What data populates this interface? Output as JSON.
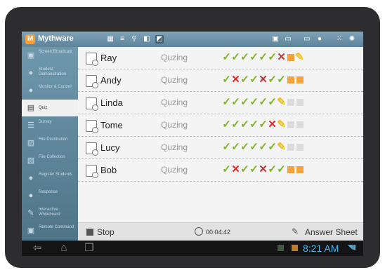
{
  "app": {
    "name": "Mythware",
    "logo_glyph": "M"
  },
  "toolbar": {
    "left_icons": [
      "grid-icon",
      "list-icon",
      "tree-icon",
      "window-icon",
      "quiz-mode-icon"
    ],
    "right_icons": [
      "screen-icon",
      "monitor-icon",
      "display-icon",
      "chat-icon",
      "apps-icon",
      "settings-icon"
    ]
  },
  "sidebar": {
    "items": [
      {
        "label": "Screen Broadcast",
        "icon": "broadcast-icon"
      },
      {
        "label": "Student Demonstration",
        "icon": "student-demo-icon"
      },
      {
        "label": "Monitor & Control",
        "icon": "monitor-control-icon"
      },
      {
        "label": "Quiz",
        "icon": "quiz-icon",
        "active": true
      },
      {
        "label": "Survey",
        "icon": "survey-icon"
      },
      {
        "label": "File Distribution",
        "icon": "file-distribution-icon"
      },
      {
        "label": "File Collection",
        "icon": "file-collection-icon"
      },
      {
        "label": "Register Students",
        "icon": "register-icon"
      },
      {
        "label": "Response",
        "icon": "response-icon"
      },
      {
        "label": "Interactive Whiteboard",
        "icon": "whiteboard-icon"
      },
      {
        "label": "Remote Command",
        "icon": "remote-command-icon"
      }
    ]
  },
  "students": [
    {
      "name": "Ray",
      "status": "Quzing",
      "marks": [
        "ok",
        "ok",
        "ok",
        "ok",
        "ok",
        "ok",
        "err",
        "orange",
        "pen"
      ]
    },
    {
      "name": "Andy",
      "status": "Quzing",
      "marks": [
        "ok",
        "err",
        "ok",
        "ok",
        "err",
        "ok",
        "ok",
        "orange",
        "orange"
      ]
    },
    {
      "name": "Linda",
      "status": "Quzing",
      "marks": [
        "ok",
        "ok",
        "ok",
        "ok",
        "ok",
        "ok",
        "pen",
        "grey",
        "grey"
      ]
    },
    {
      "name": "Tome",
      "status": "Quzing",
      "marks": [
        "ok",
        "ok",
        "ok",
        "ok",
        "ok",
        "err",
        "pen",
        "grey",
        "grey"
      ]
    },
    {
      "name": "Lucy",
      "status": "Quzing",
      "marks": [
        "ok",
        "ok",
        "ok",
        "ok",
        "ok",
        "ok",
        "pen",
        "grey",
        "grey"
      ]
    },
    {
      "name": "Bob",
      "status": "Quzing",
      "marks": [
        "ok",
        "err",
        "ok",
        "ok",
        "err",
        "ok",
        "ok",
        "orange",
        "orange"
      ]
    }
  ],
  "bottom": {
    "stop_label": "Stop",
    "timer": "00:04:42",
    "answer_sheet_label": "Answer Sheet"
  },
  "system": {
    "time": "8:21 AM"
  },
  "colors": {
    "accent": "#5f8399",
    "ok": "#7cb518",
    "error": "#e02a2a",
    "pending": "#f2c313",
    "answered": "#f4a33a",
    "time": "#4db6e8"
  }
}
